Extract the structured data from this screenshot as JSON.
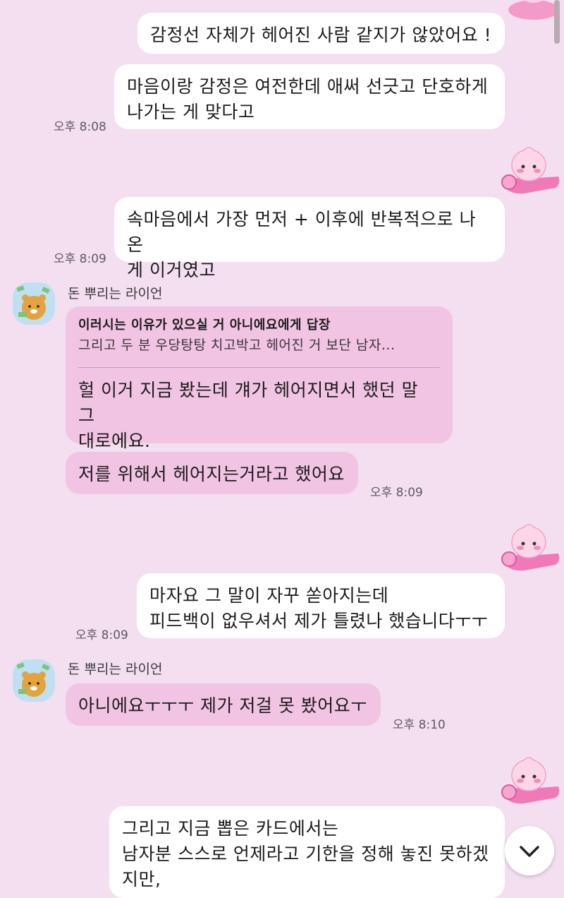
{
  "messages": {
    "m1": "감정선 자체가 헤어진 사람 같지가 않았어요 !",
    "m2": "마음이랑 감정은 여전한데 애써 선긋고 단호하게\n나가는 게 맞다고",
    "t1": "오후 8:08",
    "m3": "속마음에서 가장 먼저 + 이후에 반복적으로 나온\n게 이거였고",
    "t2": "오후 8:09",
    "sender1": "돈 뿌리는 라이언",
    "reply_title": "이러시는 이유가 있으실 거 아니에요에게 답장",
    "reply_body": "그리고 두 분 우당탕탕 치고박고 헤어진 거 보단 남자...",
    "m4": "헐 이거 지금 봤는데 걔가 헤어지면서 했던 말 그\n대로에요.",
    "m5": "저를 위해서 헤어지는거라고 했어요",
    "t3": "오후 8:09",
    "m6": "마자요 그 말이 자꾸 쏟아지는데\n피드백이 없우셔서 제가 틀렸나 했습니다ㅜㅜ",
    "t4": "오후 8:09",
    "sender2": "돈 뿌리는 라이언",
    "m7": "아니에요ㅜㅜㅜ 제가 저걸 못 봤어요ㅜ",
    "t5": "오후 8:10",
    "m8": "그리고 지금 뽑은 카드에서는\n남자분 스스로 언제라고 기한을 정해 놓진 못하겠\n지만,"
  },
  "icons": {
    "sticker": "apeach-plane-sticker",
    "avatar": "ryan-money-avatar",
    "scroll_down": "chevron-down-icon"
  },
  "colors": {
    "background": "#f3dff0",
    "my_bubble": "#ffffff",
    "their_bubble": "#f2c4e3"
  }
}
